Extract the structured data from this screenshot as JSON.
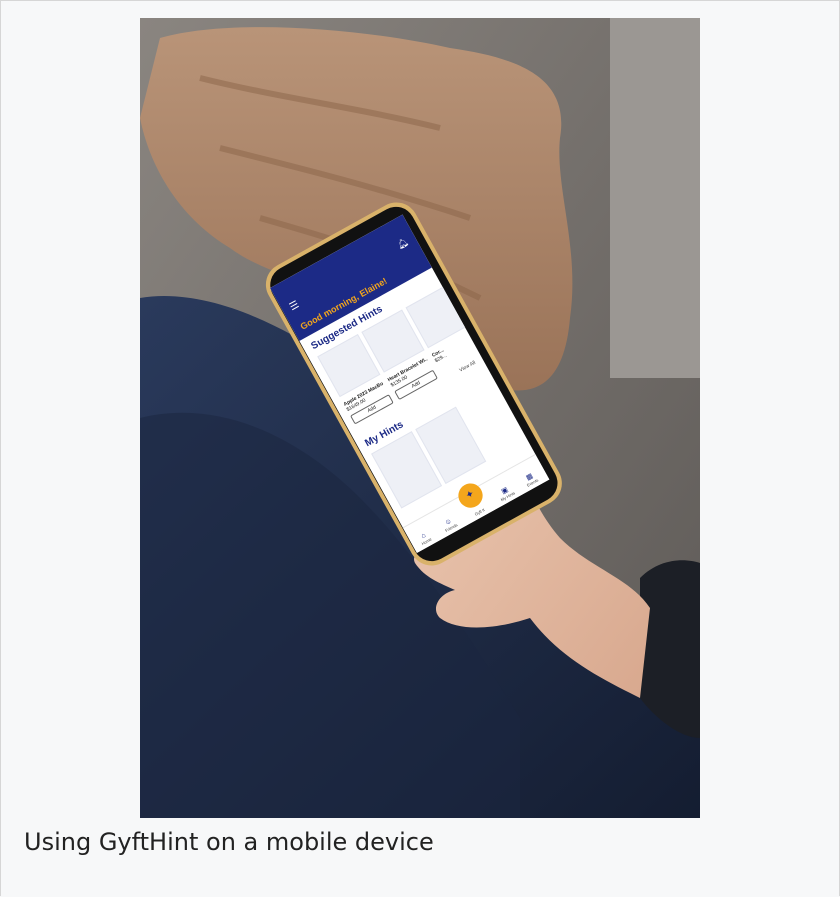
{
  "caption": "Using GyftHint on a mobile device",
  "colors": {
    "brand_navy": "#1c2a86",
    "brand_orange": "#f4a61c"
  },
  "app": {
    "greeting": "Good morning, Elaine!",
    "suggested_title": "Suggested Hints",
    "my_hints_title": "My Hints",
    "view_all": "View All",
    "cards": [
      {
        "name": "Apple 2023 MacBo...",
        "price": "$1649.00",
        "add": "Add"
      },
      {
        "name": "Heart Bracelet Wi...",
        "price": "$135.00",
        "add": "Add"
      },
      {
        "name": "Cor...",
        "price": "$29...",
        "add": ""
      }
    ],
    "nav": [
      {
        "icon": "home-icon",
        "label": "Home"
      },
      {
        "icon": "friends-icon",
        "label": "Friends"
      },
      {
        "icon": "gift-icon",
        "label": "Gyft It"
      },
      {
        "icon": "my-hints-icon",
        "label": "My Hints"
      },
      {
        "icon": "events-icon",
        "label": "Events"
      }
    ]
  }
}
